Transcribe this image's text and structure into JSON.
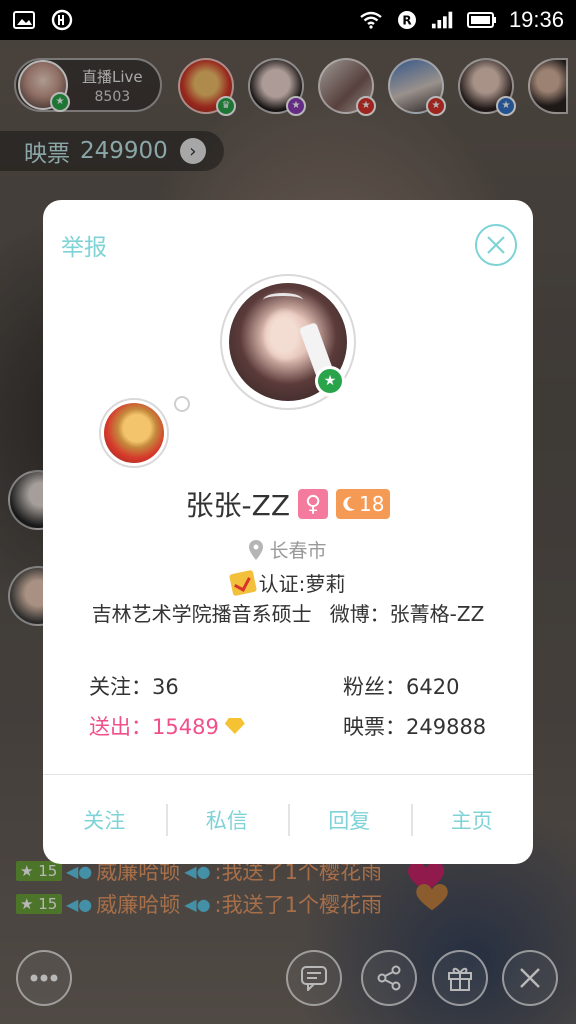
{
  "status_bar": {
    "time": "19:36",
    "icons": [
      "image-icon",
      "sync-icon",
      "wifi-icon",
      "r-icon",
      "signal-icon",
      "battery-icon"
    ]
  },
  "host": {
    "live_label": "直播Live",
    "count": "8503"
  },
  "viewers": [
    {
      "name": "viewer-1",
      "badge": "crown"
    },
    {
      "name": "viewer-2",
      "badge": "star"
    },
    {
      "name": "viewer-3",
      "badge": "star"
    },
    {
      "name": "viewer-4",
      "badge": "star"
    },
    {
      "name": "viewer-5",
      "badge": "star"
    }
  ],
  "ticket": {
    "label": "映票",
    "value": "249900"
  },
  "chat": [
    {
      "level": "15",
      "name": "威廉哈顿",
      "message": ":我送了1个樱花雨"
    },
    {
      "level": "15",
      "name": "威廉哈顿",
      "message": ":我送了1个樱花雨"
    }
  ],
  "profile": {
    "report_label": "举报",
    "name": "张张-ZZ",
    "gender_symbol": "♀",
    "level": "18",
    "location": "长春市",
    "certification": "认证:萝莉",
    "school": "吉林艺术学院播音系硕士",
    "weibo": "微博：张菁格-ZZ",
    "following": "关注：36",
    "fans": "粉丝：6420",
    "sent": "送出：15489",
    "tickets": "映票：249888"
  },
  "actions": {
    "follow": "关注",
    "message": "私信",
    "reply": "回复",
    "homepage": "主页"
  },
  "colors": {
    "accent": "#7fd3d6",
    "sent_pink": "#f0508a",
    "gender_pink": "#f47b9d",
    "level_orange": "#f59a55",
    "chat_orange": "#e89a66"
  }
}
